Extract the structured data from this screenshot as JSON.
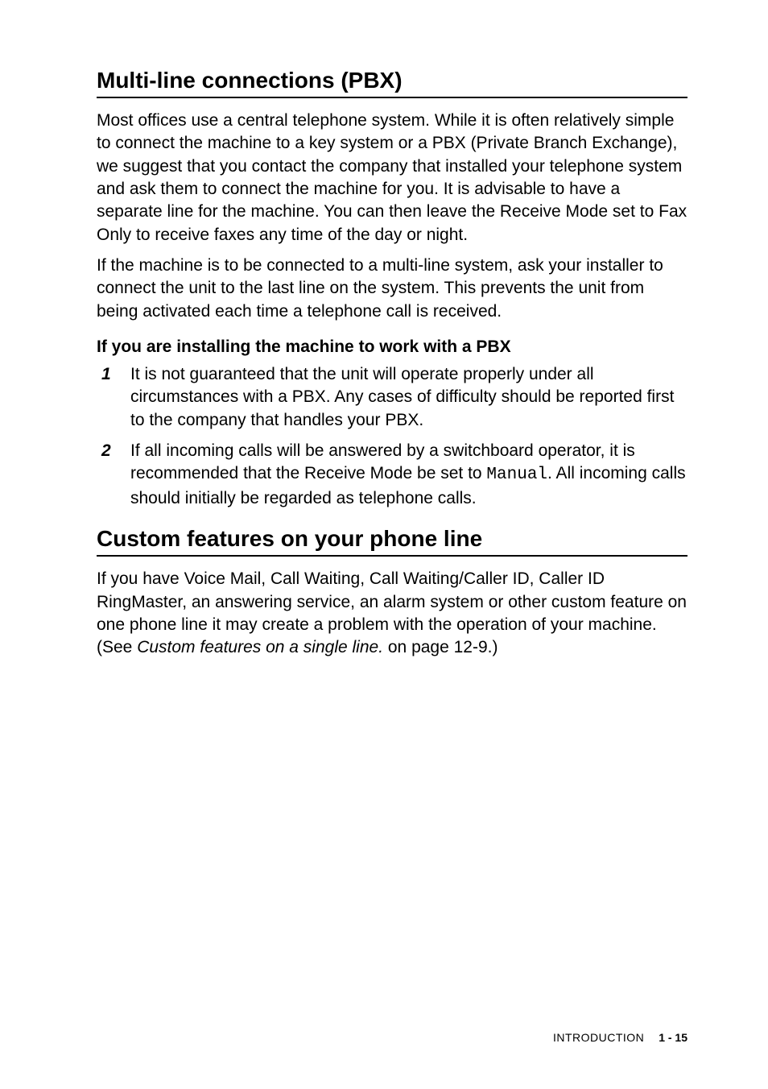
{
  "section1": {
    "heading": "Multi-line connections (PBX)",
    "para1": "Most offices use a central telephone system. While it is often relatively simple to connect the machine to a key system or a PBX (Private Branch Exchange), we suggest that you contact the company that installed your telephone system and ask them to connect the machine for you. It is advisable to have a separate line for the machine. You can then leave the Receive Mode set to Fax Only to receive faxes any time of the day or night.",
    "para2": "If the machine is to be connected to a multi-line system, ask your installer to connect the unit to the last line on the system. This prevents the unit from being activated each time a telephone call is received.",
    "subheading": "If you are installing the machine to work with a PBX",
    "list": [
      {
        "num": "1",
        "text": "It is not guaranteed that the unit will operate properly under all circumstances with a PBX. Any cases of difficulty should be reported first to the company that handles your PBX."
      },
      {
        "num": "2",
        "pre": "If all incoming calls will be answered by a switchboard operator, it is recommended that the Receive Mode be set to ",
        "mono": "Manual",
        "post": ". All incoming calls should initially be regarded as telephone calls."
      }
    ]
  },
  "section2": {
    "heading": "Custom features on your phone line",
    "para_pre": "If you have Voice Mail, Call Waiting, Call Waiting/Caller ID, Caller ID RingMaster, an answering service, an alarm system or other custom feature on one phone line it may create a problem with the operation of your machine. (See ",
    "para_italic": "Custom features on a single line.",
    "para_post": " on page 12-9.)"
  },
  "footer": {
    "label": "INTRODUCTION",
    "page": "1 - 15"
  }
}
